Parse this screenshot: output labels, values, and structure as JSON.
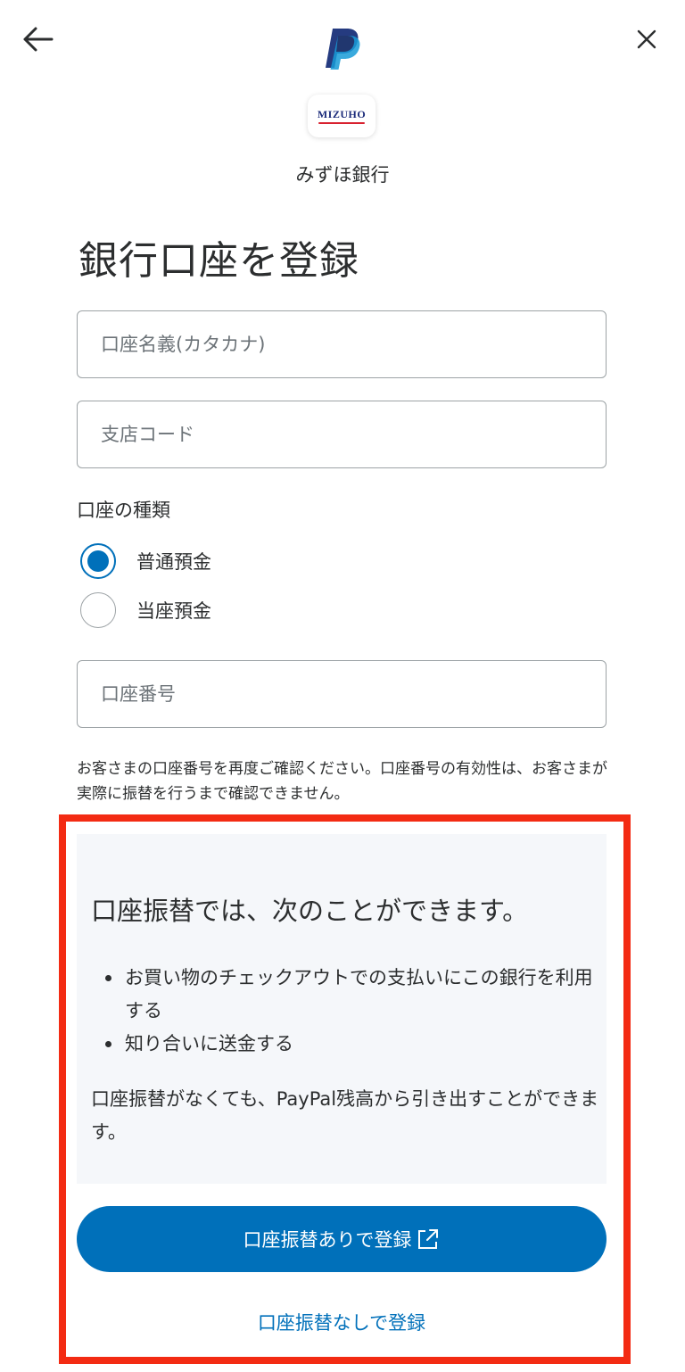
{
  "header": {
    "back_icon": "arrow-left-icon",
    "close_icon": "close-icon",
    "logo_icon": "paypal-logo-icon"
  },
  "bank": {
    "logo_text": "MIZUHO",
    "name": "みずほ銀行"
  },
  "form": {
    "title": "銀行口座を登録",
    "account_holder_placeholder": "口座名義(カタカナ)",
    "branch_code_placeholder": "支店コード",
    "account_type_label": "口座の種類",
    "account_types": [
      {
        "label": "普通預金",
        "selected": true
      },
      {
        "label": "当座預金",
        "selected": false
      }
    ],
    "account_number_placeholder": "口座番号",
    "notice": "お客さまの口座番号を再度ご確認ください。口座番号の有効性は、お客さまが実際に振替を行うまで確認できません。"
  },
  "info": {
    "heading": "口座振替では、次のことができます。",
    "bullets": [
      "お買い物のチェックアウトでの支払いにこの銀行を利用する",
      "知り合いに送金する"
    ],
    "note": "口座振替がなくても、PayPal残高から引き出すことができます。"
  },
  "actions": {
    "primary_label": "口座振替ありで登録",
    "primary_icon": "external-link-icon",
    "secondary_label": "口座振替なしで登録"
  },
  "colors": {
    "brand_blue": "#0070ba",
    "paypal_dark": "#253b80",
    "paypal_light": "#179bd7",
    "annotation_red": "#f32b13",
    "panel_bg": "#f5f7fa"
  }
}
